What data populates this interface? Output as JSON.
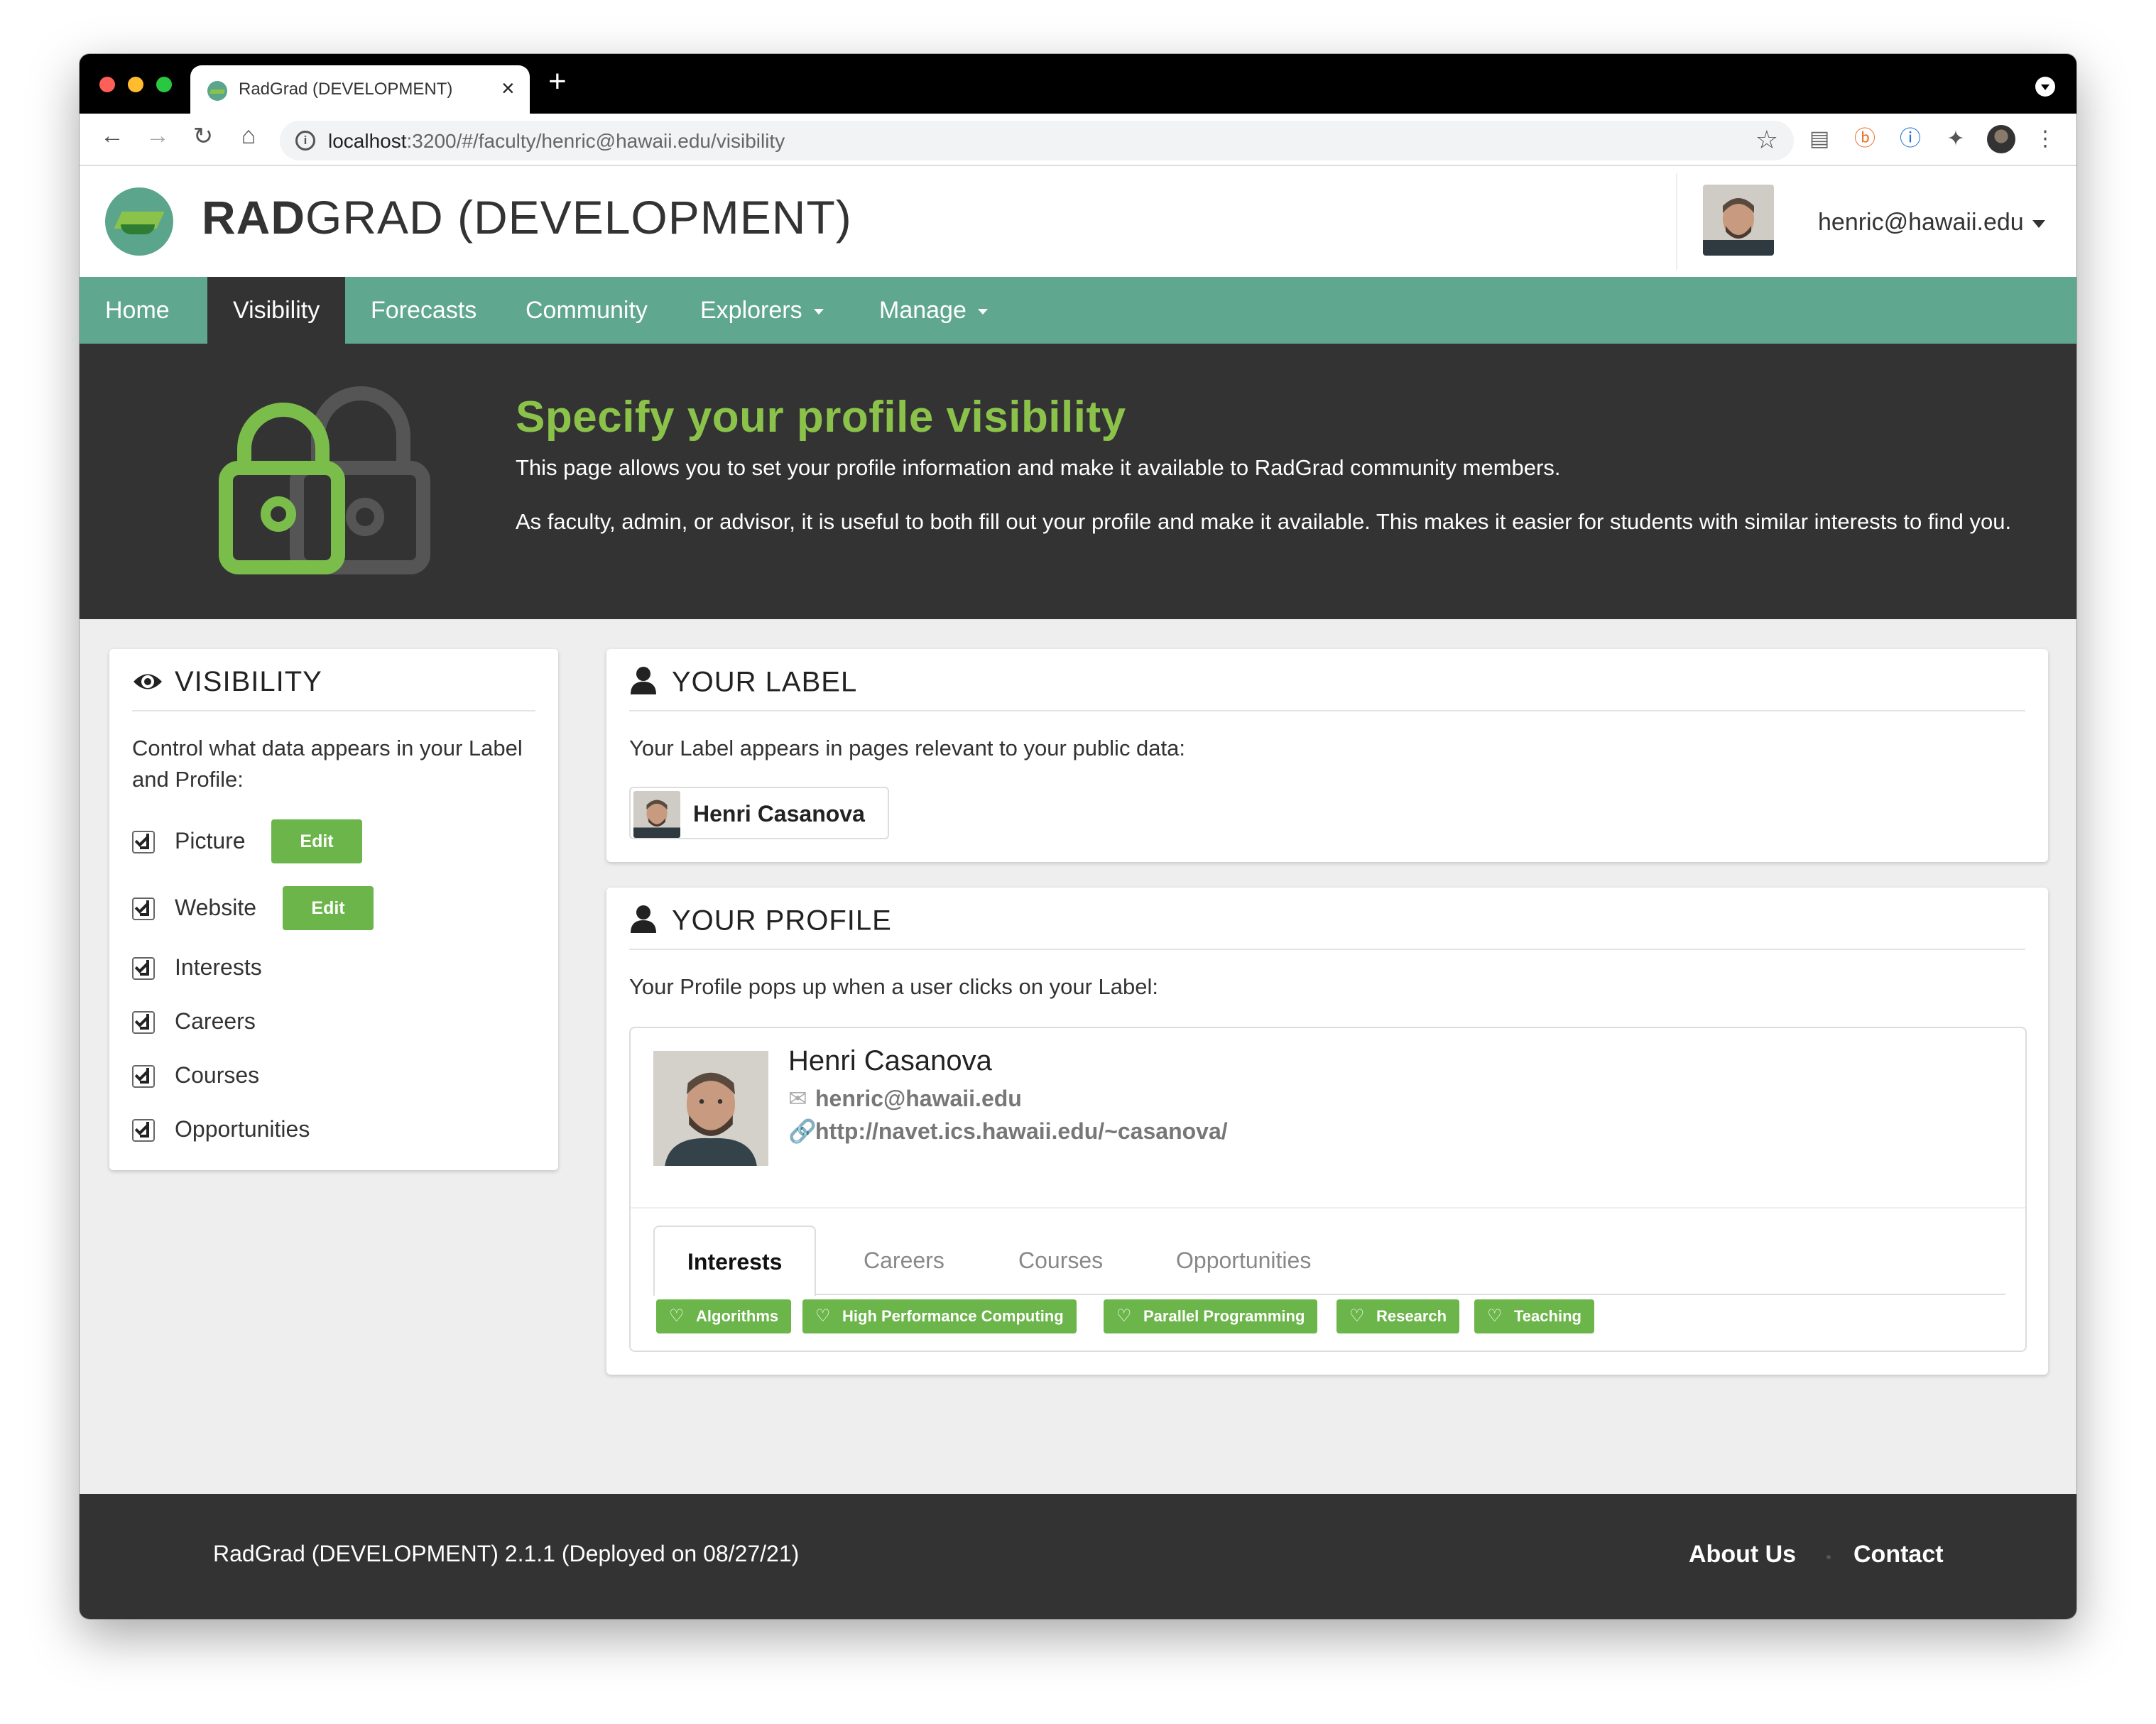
{
  "browser": {
    "tab_title": "RadGrad (DEVELOPMENT)",
    "tab_close": "×",
    "new_tab": "+",
    "url_host": "localhost",
    "url_rest": ":3200/#/faculty/henric@hawaii.edu/visibility"
  },
  "header": {
    "brand_bold": "RAD",
    "brand_rest": "GRAD (DEVELOPMENT)",
    "user_email": "henric@hawaii.edu"
  },
  "nav": {
    "items": [
      {
        "label": "Home"
      },
      {
        "label": "Visibility",
        "active": true
      },
      {
        "label": "Forecasts"
      },
      {
        "label": "Community"
      },
      {
        "label": "Explorers",
        "dropdown": true
      },
      {
        "label": "Manage",
        "dropdown": true
      }
    ]
  },
  "hero": {
    "title": "Specify your profile visibility",
    "line1": "This page allows you to set your profile information and make it available to RadGrad community members.",
    "line2": "As faculty, admin, or advisor, it is useful to both fill out your profile and make it available. This makes it easier for students with similar interests to find you."
  },
  "visibility": {
    "heading": "VISIBILITY",
    "description": "Control what data appears in your Label and Profile:",
    "edit_label": "Edit",
    "options": [
      {
        "label": "Picture",
        "checked": true
      },
      {
        "label": "Website",
        "checked": true
      },
      {
        "label": "Interests",
        "checked": true
      },
      {
        "label": "Careers",
        "checked": true
      },
      {
        "label": "Courses",
        "checked": true
      },
      {
        "label": "Opportunities",
        "checked": true
      }
    ]
  },
  "your_label": {
    "heading": "YOUR LABEL",
    "description": "Your Label appears in pages relevant to your public data:",
    "name": "Henri Casanova"
  },
  "your_profile": {
    "heading": "YOUR PROFILE",
    "description": "Your Profile pops up when a user clicks on your Label:",
    "name": "Henri Casanova",
    "email": "henric@hawaii.edu",
    "website": "http://navet.ics.hawaii.edu/~casanova/",
    "tabs": [
      "Interests",
      "Careers",
      "Courses",
      "Opportunities"
    ],
    "active_tab": "Interests",
    "interests": [
      "Algorithms",
      "High Performance Computing",
      "Parallel Programming",
      "Research",
      "Teaching"
    ]
  },
  "footer": {
    "version": "RadGrad (DEVELOPMENT) 2.1.1 (Deployed on 08/27/21)",
    "about": "About Us",
    "contact": "Contact"
  },
  "colors": {
    "nav_green": "#5fa78e",
    "accent_green": "#8bc34a",
    "button_green": "#6cb54b",
    "dark": "#333333"
  }
}
